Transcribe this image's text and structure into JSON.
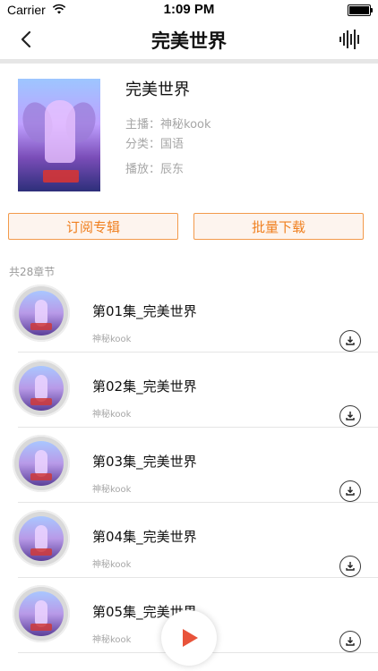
{
  "status": {
    "carrier": "Carrier",
    "time": "1:09 PM"
  },
  "nav": {
    "title": "完美世界"
  },
  "album": {
    "title": "完美世界",
    "host": "主播：神秘kook",
    "category": "分类：国语",
    "play": "播放：辰东"
  },
  "actions": {
    "subscribe": "订阅专辑",
    "batch_download": "批量下载"
  },
  "chapter_count": "共28章节",
  "episodes": [
    {
      "title": "第01集_完美世界",
      "host": "神秘kook"
    },
    {
      "title": "第02集_完美世界",
      "host": "神秘kook"
    },
    {
      "title": "第03集_完美世界",
      "host": "神秘kook"
    },
    {
      "title": "第04集_完美世界",
      "host": "神秘kook"
    },
    {
      "title": "第05集_完美世界",
      "host": "神秘kook"
    }
  ],
  "colors": {
    "accent": "#f08020",
    "accent_border": "#f39a4b",
    "play_red": "#e8533a"
  },
  "icons": {
    "back": "chevron-left-icon",
    "audio": "waveform-icon",
    "download": "download-icon",
    "play": "play-icon"
  }
}
